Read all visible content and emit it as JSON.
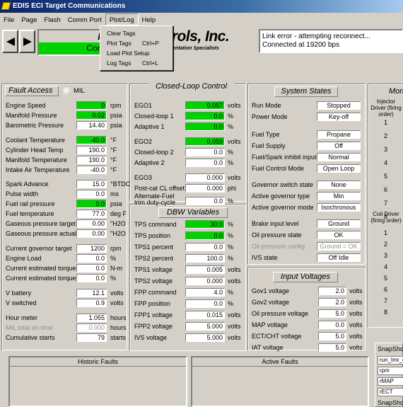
{
  "window": {
    "title": "EDIS ECI Target Communications"
  },
  "menu": [
    "File",
    "Page",
    "Flash",
    "Comm Port",
    "Plot/Log",
    "Help"
  ],
  "dropdown": [
    {
      "label": "Clear Tags",
      "shortcut": ""
    },
    {
      "label": "Plot Tags",
      "shortcut": "Ctrl+P"
    },
    {
      "label": "Load Plot Setup",
      "shortcut": ""
    },
    {
      "label": "Log Tags",
      "shortcut": "Ctrl+L"
    }
  ],
  "status": {
    "fault": "Faul",
    "connected": "Connect"
  },
  "brand": {
    "name": "ntrols, Inc.",
    "tagline": "nd Instrumentation Specialists"
  },
  "link_error": {
    "line1": "Link error - attempting reconnect...",
    "line2": "Connected at 19200 bps"
  },
  "fault_access": {
    "title": "Fault Access",
    "mil": "MIL",
    "rows": [
      {
        "label": "Engine Speed",
        "value": "0",
        "unit": "rpm",
        "green": true
      },
      {
        "label": "Manifold Pressure",
        "value": "0.02",
        "unit": "psia",
        "green": true
      },
      {
        "label": "Barometric Pressure",
        "value": "14.40",
        "unit": "psia",
        "green": false
      },
      {
        "label": "Coolant Temperature",
        "value": "-40.0",
        "unit": "°F",
        "green": true
      },
      {
        "label": "Cylinder Head Temp",
        "value": "190.0",
        "unit": "°F",
        "green": false
      },
      {
        "label": "Manifold Temperature",
        "value": "190.0",
        "unit": "°F",
        "green": false
      },
      {
        "label": "Intake Air Temperature",
        "value": "-40.0",
        "unit": "°F",
        "green": false
      },
      {
        "label": "Spark Advance",
        "value": "15.0",
        "unit": "°BTDC",
        "green": false
      },
      {
        "label": "Pulse width",
        "value": "0.0",
        "unit": "ms",
        "green": false
      },
      {
        "label": "Fuel rail pressure",
        "value": "0.0",
        "unit": "psia",
        "green": true
      },
      {
        "label": "Fuel temperature",
        "value": "77.0",
        "unit": "deg F",
        "green": false
      },
      {
        "label": "Gaseous pressure target",
        "value": "0.00",
        "unit": "\"H2O",
        "green": false
      },
      {
        "label": "Gaseous pressure actual",
        "value": "0.00",
        "unit": "\"H2O",
        "green": false
      },
      {
        "label": "Current governor target",
        "value": "1200",
        "unit": "rpm",
        "green": false
      },
      {
        "label": "Engine Load",
        "value": "0.0",
        "unit": "%",
        "green": false
      },
      {
        "label": "Current estimated torque",
        "value": "0.0",
        "unit": "N-m",
        "green": false
      },
      {
        "label": "Current estimated torque",
        "value": "0.0",
        "unit": "%",
        "green": false
      },
      {
        "label": "V battery",
        "value": "12.1",
        "unit": "volts",
        "green": false
      },
      {
        "label": "V switched",
        "value": "0.9",
        "unit": "volts",
        "green": false
      },
      {
        "label": "Hour meter",
        "value": "1.055",
        "unit": "hours",
        "green": false
      },
      {
        "label": "MIL total on-time",
        "value": "0.000",
        "unit": "hours",
        "green": false,
        "gray": true
      },
      {
        "label": "Cumulative starts",
        "value": "79",
        "unit": "starts",
        "green": false
      }
    ]
  },
  "closed_loop": {
    "title": "Closed-Loop Control",
    "rows": [
      {
        "label": "EGO1",
        "value": "0.057",
        "unit": "volts",
        "green": true
      },
      {
        "label": "Closed-loop 1",
        "value": "0.0",
        "unit": "%",
        "green": true
      },
      {
        "label": "Adaptive 1",
        "value": "0.0",
        "unit": "%",
        "green": true
      },
      {
        "label": "EGO2",
        "value": "0.059",
        "unit": "volts",
        "green": true
      },
      {
        "label": "Closed-loop 2",
        "value": "0.0",
        "unit": "%",
        "green": false
      },
      {
        "label": "Adaptive 2",
        "value": "0.0",
        "unit": "%",
        "green": false
      },
      {
        "label": "EGO3",
        "value": "0.000",
        "unit": "volts",
        "green": false
      },
      {
        "label": "Post-cat CL offset",
        "value": "0.000",
        "unit": "phi",
        "green": false
      },
      {
        "label": "Alternate-Fuel trim duty-cycle",
        "value": "0.0",
        "unit": "%",
        "green": false
      }
    ]
  },
  "dbw": {
    "title": "DBW Variables",
    "rows": [
      {
        "label": "TPS command",
        "value": "30.0",
        "unit": "%",
        "green": true
      },
      {
        "label": "TPS position",
        "value": "0.0",
        "unit": "%",
        "green": true
      },
      {
        "label": "TPS1 percent",
        "value": "0.0",
        "unit": "%",
        "green": false
      },
      {
        "label": "TPS2 percent",
        "value": "100.0",
        "unit": "%",
        "green": false
      },
      {
        "label": "TPS1 voltage",
        "value": "0.005",
        "unit": "volts",
        "green": false
      },
      {
        "label": "TPS2 voltage",
        "value": "0.000",
        "unit": "volts",
        "green": false
      },
      {
        "label": "FPP command",
        "value": "4.0",
        "unit": "%",
        "green": false
      },
      {
        "label": "FPP position",
        "value": "0.0",
        "unit": "%",
        "green": false
      },
      {
        "label": "FPP1 voltage",
        "value": "0.015",
        "unit": "volts",
        "green": false
      },
      {
        "label": "FPP2 voltage",
        "value": "5.000",
        "unit": "volts",
        "green": false
      },
      {
        "label": "IVS voltage",
        "value": "5.000",
        "unit": "volts",
        "green": false
      }
    ]
  },
  "system_states": {
    "title": "System States",
    "rows": [
      {
        "label": "Run Mode",
        "value": "Stopped"
      },
      {
        "label": "Power Mode",
        "value": "Key-off"
      },
      {
        "label": "Fuel Type",
        "value": "Propane"
      },
      {
        "label": "Fuel Supply",
        "value": "Off"
      },
      {
        "label": "Fuel/Spark inhibit input",
        "value": "Normal"
      },
      {
        "label": "Fuel Control Mode",
        "value": "Open Loop"
      },
      {
        "label": "Governor switch state",
        "value": "None"
      },
      {
        "label": "Active governor type",
        "value": "Min"
      },
      {
        "label": "Active governor mode",
        "value": "Isochronous"
      },
      {
        "label": "Brake input level",
        "value": "Ground"
      },
      {
        "label": "Oil pressure state",
        "value": "OK"
      },
      {
        "label": "Oil pressure config",
        "value": "Ground = OK",
        "gray": true
      },
      {
        "label": "IVS state",
        "value": "Off Idle"
      }
    ]
  },
  "input_voltages": {
    "title": "Input Voltages",
    "rows": [
      {
        "label": "Gov1 voltage",
        "value": "2.0",
        "unit": "volts"
      },
      {
        "label": "Gov2 voltage",
        "value": "2.0",
        "unit": "volts"
      },
      {
        "label": "Oil pressure voltage",
        "value": "5.0",
        "unit": "volts"
      },
      {
        "label": "MAP voltage",
        "value": "0.0",
        "unit": "volts"
      },
      {
        "label": "ECT/CHT voltage",
        "value": "5.0",
        "unit": "volts"
      },
      {
        "label": "IAT voltage",
        "value": "5.0",
        "unit": "volts"
      }
    ]
  },
  "monitor": {
    "title": "Moni",
    "injector_label": "Injector Driver (firing order)",
    "injectors": [
      "1",
      "2",
      "3",
      "4",
      "5",
      "6",
      "7",
      "8"
    ],
    "coil_label": "Coil Driver (firing order)",
    "coils": [
      "1",
      "2",
      "3",
      "4",
      "5",
      "6",
      "7",
      "8"
    ]
  },
  "snapshot": {
    "title": "SnapSho",
    "items": [
      "run_tmr_c",
      "rpm",
      "rMAP",
      "rECT"
    ],
    "title2": "SnapSho"
  },
  "historic_faults": {
    "title": "Historic Faults"
  },
  "active_faults": {
    "title": "Active Faults"
  },
  "colors": {
    "green": "#00d200",
    "face": "#d4d0c8"
  }
}
